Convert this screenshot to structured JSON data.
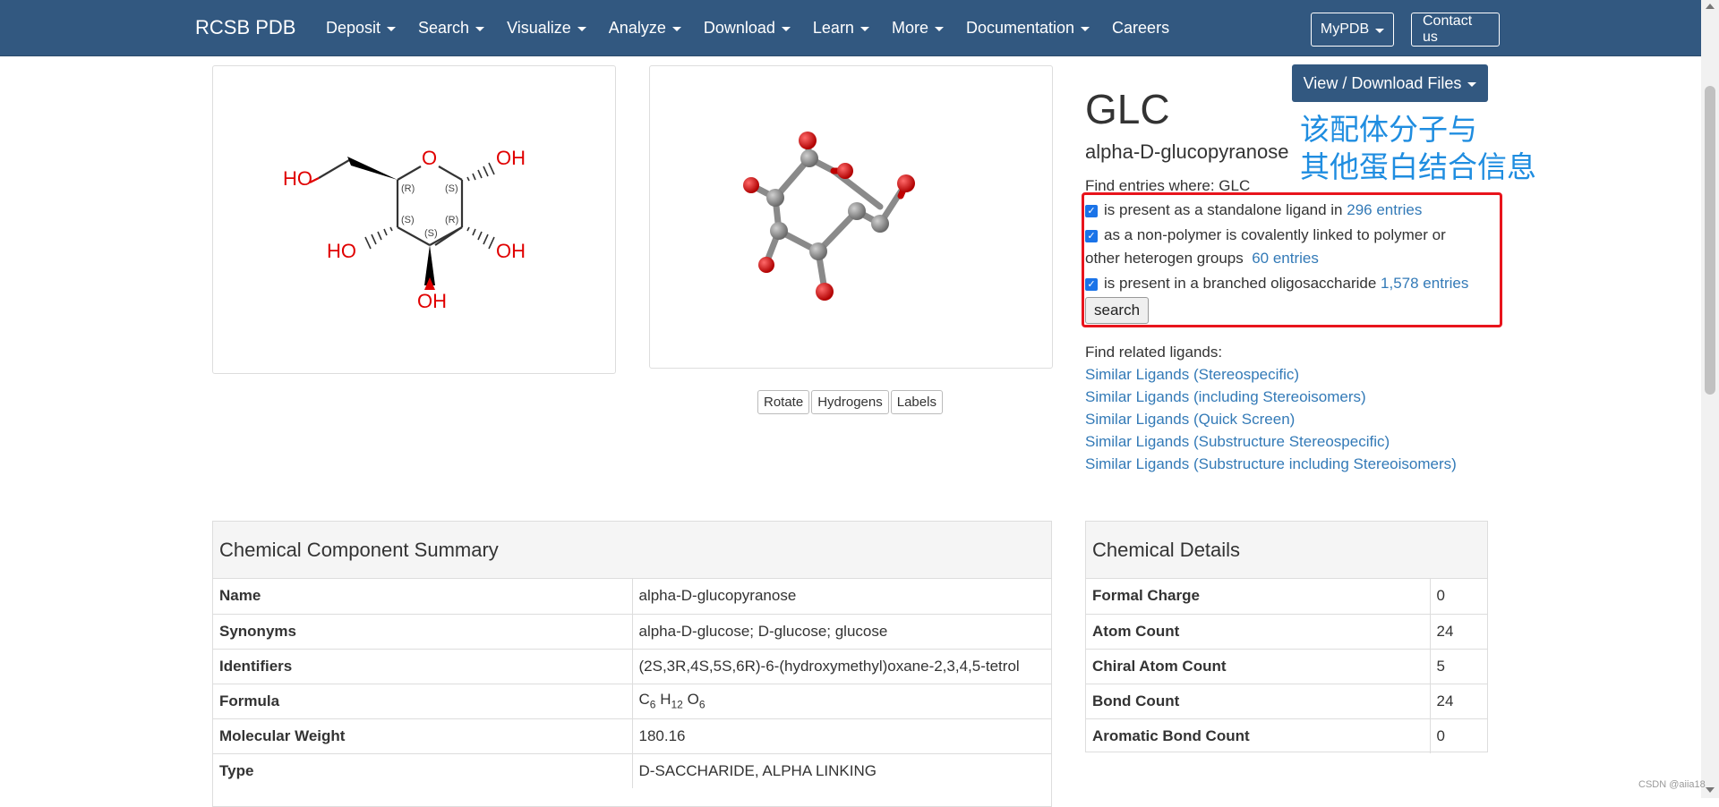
{
  "navbar": {
    "brand": "RCSB PDB",
    "items": [
      {
        "label": "Deposit",
        "dropdown": true
      },
      {
        "label": "Search",
        "dropdown": true
      },
      {
        "label": "Visualize",
        "dropdown": true
      },
      {
        "label": "Analyze",
        "dropdown": true
      },
      {
        "label": "Download",
        "dropdown": true
      },
      {
        "label": "Learn",
        "dropdown": true
      },
      {
        "label": "More",
        "dropdown": true
      },
      {
        "label": "Documentation",
        "dropdown": true
      },
      {
        "label": "Careers",
        "dropdown": false
      }
    ],
    "mypdb_label": "MyPDB",
    "contact_label": "Contact us"
  },
  "structure_2d": {
    "labels": [
      "HO",
      "O",
      "OH",
      "HO",
      "OH",
      "OH",
      "(R)",
      "(S)",
      "(S)",
      "(S)",
      "(R)"
    ]
  },
  "jsmol": {
    "buttons": [
      "Rotate",
      "Hydrogens",
      "Labels"
    ]
  },
  "ligand": {
    "view_download_label": "View / Download Files",
    "id": "GLC",
    "name": "alpha-D-glucopyranose",
    "annotation_line1": "该配体分子与",
    "annotation_line2": "其他蛋白结合信息",
    "find_entries_label": "Find entries where: GLC",
    "checks": [
      {
        "text": "is present as a standalone ligand in",
        "link": "296 entries"
      },
      {
        "text": "as a non-polymer is covalently linked to polymer or",
        "text2": "other heterogen groups",
        "link": "60 entries"
      },
      {
        "text": "is present in a branched oligosaccharide",
        "link": "1,578 entries"
      }
    ],
    "search_label": "search",
    "related_title": "Find related ligands:",
    "related": [
      "Similar Ligands (Stereospecific)",
      "Similar Ligands (including Stereoisomers)",
      "Similar Ligands (Quick Screen)",
      "Similar Ligands (Substructure Stereospecific)",
      "Similar Ligands (Substructure including Stereoisomers)"
    ]
  },
  "summary": {
    "title": "Chemical Component Summary",
    "rows": [
      {
        "key": "Name",
        "value": "alpha-D-glucopyranose"
      },
      {
        "key": "Synonyms",
        "value": "alpha-D-glucose; D-glucose; glucose"
      },
      {
        "key": "Identifiers",
        "value": "(2S,3R,4S,5S,6R)-6-(hydroxymethyl)oxane-2,3,4,5-tetrol"
      },
      {
        "key": "Formula",
        "value": "C6 H12 O6"
      },
      {
        "key": "Molecular Weight",
        "value": "180.16"
      },
      {
        "key": "Type",
        "value": "D-SACCHARIDE, ALPHA LINKING"
      }
    ],
    "formula": {
      "c": "C",
      "c_n": "6",
      "h": "H",
      "h_n": "12",
      "o": "O",
      "o_n": "6"
    }
  },
  "details": {
    "title": "Chemical Details",
    "rows": [
      {
        "key": "Formal Charge",
        "value": "0"
      },
      {
        "key": "Atom Count",
        "value": "24"
      },
      {
        "key": "Chiral Atom Count",
        "value": "5"
      },
      {
        "key": "Bond Count",
        "value": "24"
      },
      {
        "key": "Aromatic Bond Count",
        "value": "0"
      }
    ]
  },
  "watermark": "CSDN @aiia18",
  "colors": {
    "navbar": "#325880",
    "link": "#337ab7",
    "highlight_box": "#e8141c",
    "annotation": "#1f8de0",
    "oxygen": "#e00000",
    "carbon": "#8a8a8a"
  }
}
